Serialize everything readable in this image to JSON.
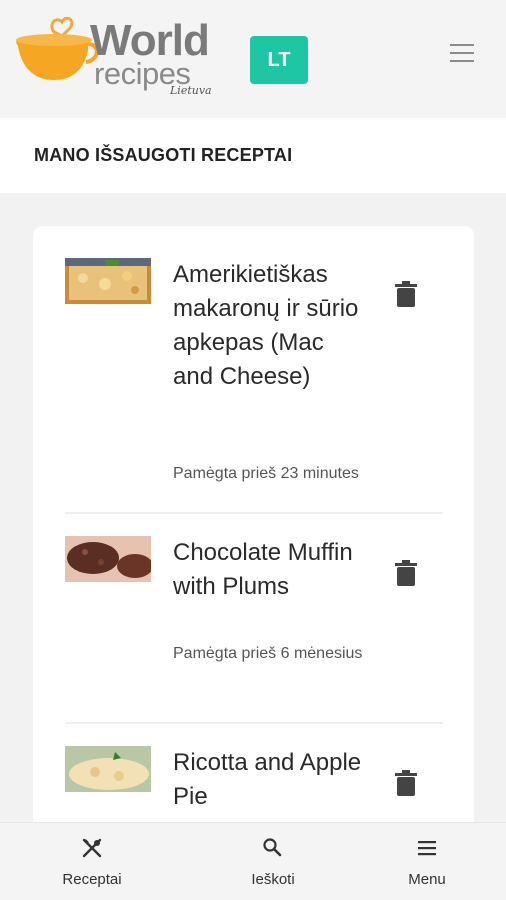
{
  "header": {
    "logo": {
      "word": "World",
      "recipes": "recipes",
      "country": "Lietuva"
    },
    "language_badge": "LT",
    "accent_color": "#1dc7a6",
    "menu_icon": "hamburger-icon"
  },
  "page": {
    "title": "MANO IŠSAUGOTI RECEPTAI"
  },
  "recipes": [
    {
      "name": "Amerikietiškas makaronų ir sūrio apkepas (Mac and Cheese)",
      "saved": "Pamėgta prieš 23 minutes",
      "thumb": "mac-and-cheese-photo",
      "delete_icon": "trash-icon"
    },
    {
      "name": "Chocolate Muffin with Plums",
      "saved": "Pamėgta prieš 6 mėnesius",
      "thumb": "chocolate-muffin-photo",
      "delete_icon": "trash-icon"
    },
    {
      "name": "Ricotta and Apple Pie",
      "saved": "",
      "thumb": "ricotta-apple-pie-photo",
      "delete_icon": "trash-icon"
    }
  ],
  "bottom_nav": {
    "items": [
      {
        "label": "Receptai",
        "icon": "fork-knife-icon"
      },
      {
        "label": "Ieškoti",
        "icon": "search-icon"
      },
      {
        "label": "Menu",
        "icon": "menu-icon"
      }
    ]
  }
}
